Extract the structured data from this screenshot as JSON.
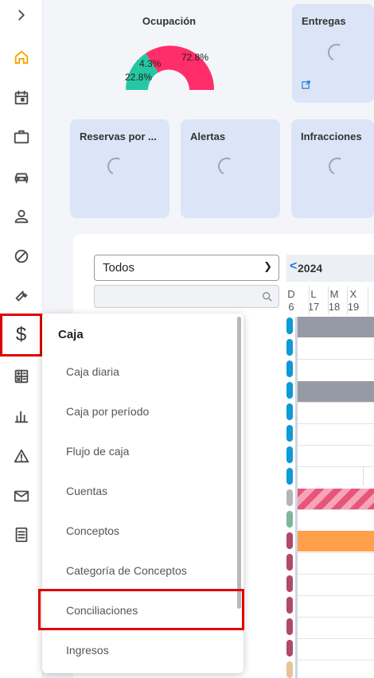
{
  "sidebar": {
    "icons": [
      "expand-chevron-icon",
      "home-icon",
      "calendar-icon",
      "briefcase-icon",
      "car-icon",
      "user-icon",
      "block-icon",
      "wrench-icon",
      "dollar-icon",
      "calculator-icon",
      "bar-chart-icon",
      "warning-icon",
      "mail-icon",
      "receipt-icon"
    ],
    "dollar_glyph": "$"
  },
  "dashboard": {
    "occupancy": {
      "title": "Ocupación",
      "slices": [
        {
          "label": "72.8%",
          "value": 72.8,
          "color": "#ff2d6a"
        },
        {
          "label": "4.3%",
          "value": 4.3,
          "color": "#2fb8a0"
        },
        {
          "label": "22.8%",
          "value": 22.8,
          "color": "#26c6a3"
        }
      ]
    },
    "cards": {
      "deliveries": "Entregas",
      "reservations": "Reservas por ...",
      "alerts": "Alertas",
      "infractions": "Infracciones"
    }
  },
  "panel": {
    "filter_select": "Todos",
    "search_placeholder": "",
    "calendar": {
      "year": "2024",
      "prev_glyph": "<",
      "day_letters": [
        "D",
        "L",
        "M",
        "X"
      ],
      "day_numbers": [
        "6",
        "17",
        "18",
        "19"
      ]
    }
  },
  "menu": {
    "title": "Caja",
    "items": [
      "Caja diaria",
      "Caja por período",
      "Flujo de caja",
      "Cuentas",
      "Conceptos",
      "Categoría de Conceptos",
      "Conciliaciones",
      "Ingresos"
    ]
  },
  "colors": {
    "accent": "#1f7bd8",
    "home": "#f5a300",
    "card_bg": "#dbe5f7",
    "highlight": "#e00000"
  }
}
